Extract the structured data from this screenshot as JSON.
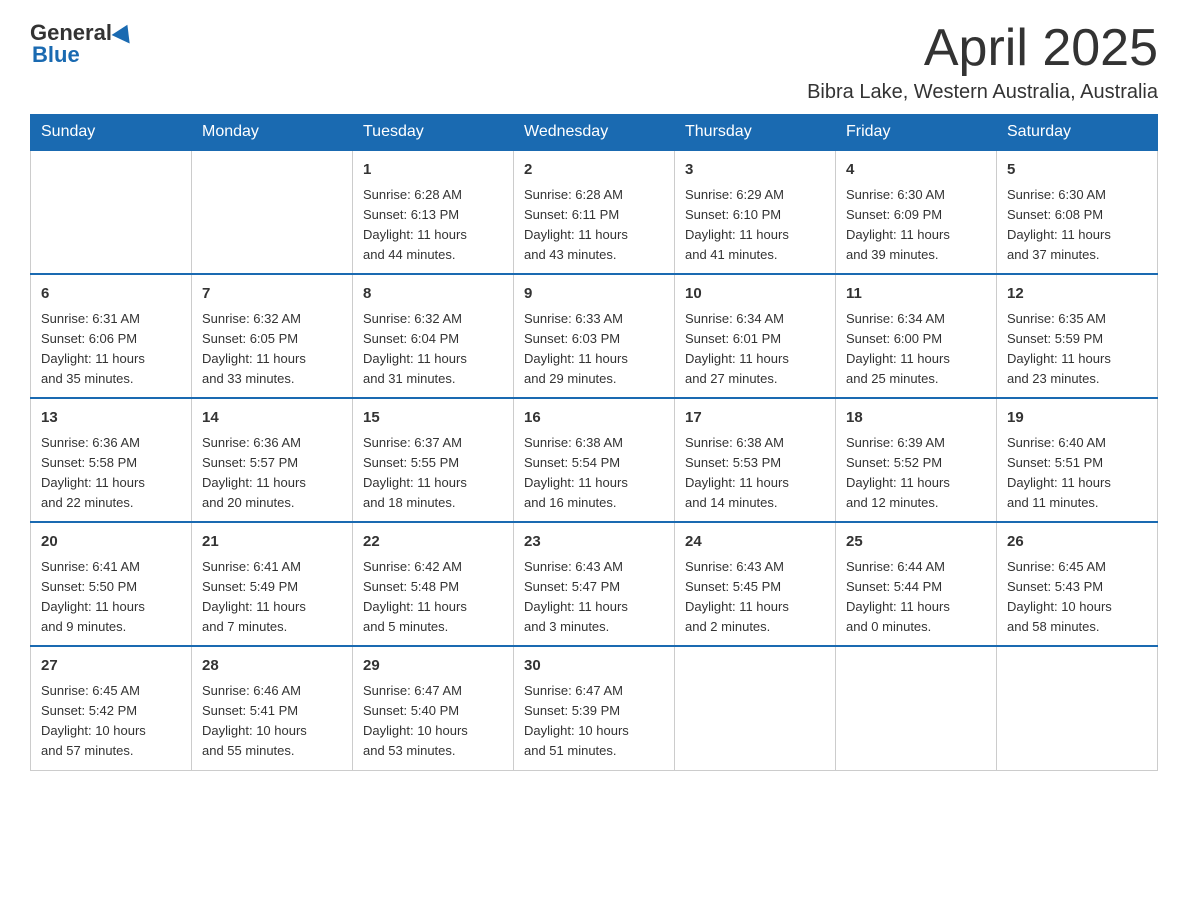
{
  "header": {
    "logo_general": "General",
    "logo_blue": "Blue",
    "month_title": "April 2025",
    "location": "Bibra Lake, Western Australia, Australia"
  },
  "days_of_week": [
    "Sunday",
    "Monday",
    "Tuesday",
    "Wednesday",
    "Thursday",
    "Friday",
    "Saturday"
  ],
  "weeks": [
    [
      {
        "day": "",
        "info": ""
      },
      {
        "day": "",
        "info": ""
      },
      {
        "day": "1",
        "info": "Sunrise: 6:28 AM\nSunset: 6:13 PM\nDaylight: 11 hours\nand 44 minutes."
      },
      {
        "day": "2",
        "info": "Sunrise: 6:28 AM\nSunset: 6:11 PM\nDaylight: 11 hours\nand 43 minutes."
      },
      {
        "day": "3",
        "info": "Sunrise: 6:29 AM\nSunset: 6:10 PM\nDaylight: 11 hours\nand 41 minutes."
      },
      {
        "day": "4",
        "info": "Sunrise: 6:30 AM\nSunset: 6:09 PM\nDaylight: 11 hours\nand 39 minutes."
      },
      {
        "day": "5",
        "info": "Sunrise: 6:30 AM\nSunset: 6:08 PM\nDaylight: 11 hours\nand 37 minutes."
      }
    ],
    [
      {
        "day": "6",
        "info": "Sunrise: 6:31 AM\nSunset: 6:06 PM\nDaylight: 11 hours\nand 35 minutes."
      },
      {
        "day": "7",
        "info": "Sunrise: 6:32 AM\nSunset: 6:05 PM\nDaylight: 11 hours\nand 33 minutes."
      },
      {
        "day": "8",
        "info": "Sunrise: 6:32 AM\nSunset: 6:04 PM\nDaylight: 11 hours\nand 31 minutes."
      },
      {
        "day": "9",
        "info": "Sunrise: 6:33 AM\nSunset: 6:03 PM\nDaylight: 11 hours\nand 29 minutes."
      },
      {
        "day": "10",
        "info": "Sunrise: 6:34 AM\nSunset: 6:01 PM\nDaylight: 11 hours\nand 27 minutes."
      },
      {
        "day": "11",
        "info": "Sunrise: 6:34 AM\nSunset: 6:00 PM\nDaylight: 11 hours\nand 25 minutes."
      },
      {
        "day": "12",
        "info": "Sunrise: 6:35 AM\nSunset: 5:59 PM\nDaylight: 11 hours\nand 23 minutes."
      }
    ],
    [
      {
        "day": "13",
        "info": "Sunrise: 6:36 AM\nSunset: 5:58 PM\nDaylight: 11 hours\nand 22 minutes."
      },
      {
        "day": "14",
        "info": "Sunrise: 6:36 AM\nSunset: 5:57 PM\nDaylight: 11 hours\nand 20 minutes."
      },
      {
        "day": "15",
        "info": "Sunrise: 6:37 AM\nSunset: 5:55 PM\nDaylight: 11 hours\nand 18 minutes."
      },
      {
        "day": "16",
        "info": "Sunrise: 6:38 AM\nSunset: 5:54 PM\nDaylight: 11 hours\nand 16 minutes."
      },
      {
        "day": "17",
        "info": "Sunrise: 6:38 AM\nSunset: 5:53 PM\nDaylight: 11 hours\nand 14 minutes."
      },
      {
        "day": "18",
        "info": "Sunrise: 6:39 AM\nSunset: 5:52 PM\nDaylight: 11 hours\nand 12 minutes."
      },
      {
        "day": "19",
        "info": "Sunrise: 6:40 AM\nSunset: 5:51 PM\nDaylight: 11 hours\nand 11 minutes."
      }
    ],
    [
      {
        "day": "20",
        "info": "Sunrise: 6:41 AM\nSunset: 5:50 PM\nDaylight: 11 hours\nand 9 minutes."
      },
      {
        "day": "21",
        "info": "Sunrise: 6:41 AM\nSunset: 5:49 PM\nDaylight: 11 hours\nand 7 minutes."
      },
      {
        "day": "22",
        "info": "Sunrise: 6:42 AM\nSunset: 5:48 PM\nDaylight: 11 hours\nand 5 minutes."
      },
      {
        "day": "23",
        "info": "Sunrise: 6:43 AM\nSunset: 5:47 PM\nDaylight: 11 hours\nand 3 minutes."
      },
      {
        "day": "24",
        "info": "Sunrise: 6:43 AM\nSunset: 5:45 PM\nDaylight: 11 hours\nand 2 minutes."
      },
      {
        "day": "25",
        "info": "Sunrise: 6:44 AM\nSunset: 5:44 PM\nDaylight: 11 hours\nand 0 minutes."
      },
      {
        "day": "26",
        "info": "Sunrise: 6:45 AM\nSunset: 5:43 PM\nDaylight: 10 hours\nand 58 minutes."
      }
    ],
    [
      {
        "day": "27",
        "info": "Sunrise: 6:45 AM\nSunset: 5:42 PM\nDaylight: 10 hours\nand 57 minutes."
      },
      {
        "day": "28",
        "info": "Sunrise: 6:46 AM\nSunset: 5:41 PM\nDaylight: 10 hours\nand 55 minutes."
      },
      {
        "day": "29",
        "info": "Sunrise: 6:47 AM\nSunset: 5:40 PM\nDaylight: 10 hours\nand 53 minutes."
      },
      {
        "day": "30",
        "info": "Sunrise: 6:47 AM\nSunset: 5:39 PM\nDaylight: 10 hours\nand 51 minutes."
      },
      {
        "day": "",
        "info": ""
      },
      {
        "day": "",
        "info": ""
      },
      {
        "day": "",
        "info": ""
      }
    ]
  ]
}
